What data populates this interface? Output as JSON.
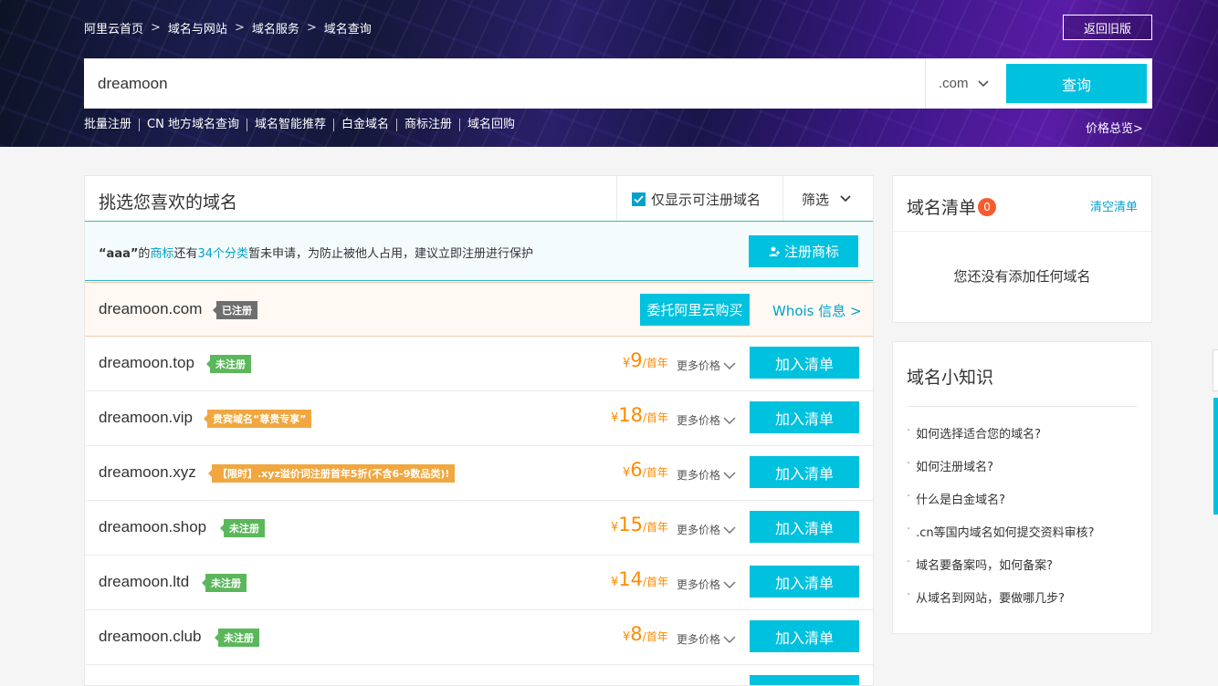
{
  "breadcrumb": {
    "items": [
      "阿里云首页",
      "域名与网站",
      "域名服务",
      "域名查询"
    ],
    "separator": ">"
  },
  "header": {
    "back_old_version": "返回旧版"
  },
  "search": {
    "value": "dreamoon",
    "suffix": ".com",
    "query_label": "查询"
  },
  "quick_links": [
    "批量注册",
    "CN 地方域名查询",
    "域名智能推荐",
    "白金域名",
    "商标注册",
    "域名回购"
  ],
  "price_overview": "价格总览>",
  "main": {
    "title": "挑选您喜欢的域名",
    "only_available": "仅显示可注册域名",
    "filter": "筛选"
  },
  "trademark": {
    "keyword": "“aaa”",
    "text_1": "的",
    "link_trademark": "商标",
    "text_2": "还有",
    "link_categories": "34个分类",
    "text_3": "暂未申请，为防止被他人占用，建议立即注册进行保护",
    "button": "注册商标"
  },
  "registered_row": {
    "domain": "dreamoon.com",
    "badge": "已注册",
    "delegate": "委托阿里云购买",
    "whois": "Whois 信息 >"
  },
  "domain_rows": [
    {
      "domain": "dreamoon.top",
      "badge": "未注册",
      "badge_type": "green",
      "price_symbol": "¥",
      "price": "9",
      "unit": "/首年",
      "more": "更多价格",
      "add": "加入清单"
    },
    {
      "domain": "dreamoon.vip",
      "badge": "贵宾域名“尊贵专享”",
      "badge_type": "orange",
      "price_symbol": "¥",
      "price": "18",
      "unit": "/首年",
      "more": "更多价格",
      "add": "加入清单"
    },
    {
      "domain": "dreamoon.xyz",
      "badge": "【限时】.xyz溢价词注册首年5折(不含6-9数品类)!",
      "badge_type": "orange",
      "price_symbol": "¥",
      "price": "6",
      "unit": "/首年",
      "more": "更多价格",
      "add": "加入清单"
    },
    {
      "domain": "dreamoon.shop",
      "badge": "未注册",
      "badge_type": "green",
      "price_symbol": "¥",
      "price": "15",
      "unit": "/首年",
      "more": "更多价格",
      "add": "加入清单"
    },
    {
      "domain": "dreamoon.ltd",
      "badge": "未注册",
      "badge_type": "green",
      "price_symbol": "¥",
      "price": "14",
      "unit": "/首年",
      "more": "更多价格",
      "add": "加入清单"
    },
    {
      "domain": "dreamoon.club",
      "badge": "未注册",
      "badge_type": "green",
      "price_symbol": "¥",
      "price": "8",
      "unit": "/首年",
      "more": "更多价格",
      "add": "加入清单"
    }
  ],
  "cart": {
    "title": "域名清单",
    "count": "0",
    "clear": "清空清单",
    "empty": "您还没有添加任何域名"
  },
  "tips": {
    "title": "域名小知识",
    "items": [
      "如何选择适合您的域名?",
      "如何注册域名?",
      "什么是白金域名?",
      ".cn等国内域名如何提交资料审核?",
      "域名要备案吗，如何备案?",
      "从域名到网站，要做哪几步?"
    ]
  },
  "colors": {
    "accent": "#00c1de",
    "link": "#00a2ca",
    "price": "#ff8a00",
    "badge_green": "#5bb75b",
    "badge_orange": "#f0a73f",
    "badge_gray": "#6e6e6e",
    "cart_count": "#f85b2f"
  }
}
